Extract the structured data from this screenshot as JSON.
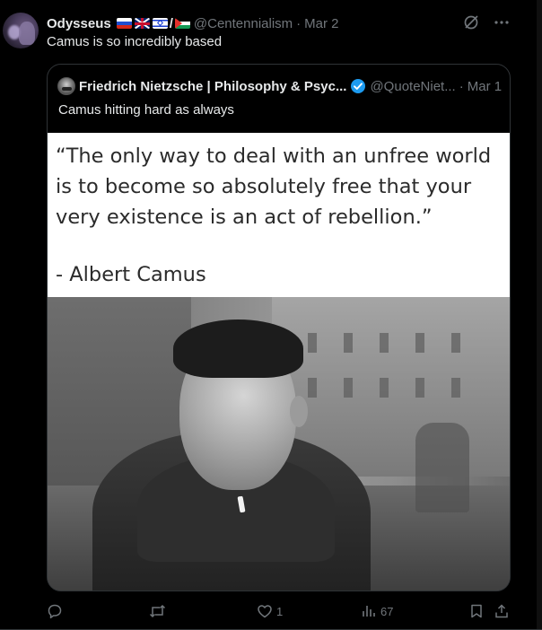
{
  "author": {
    "display_name": "Odysseus",
    "flag_separator": "/",
    "handle": "@Centennialism",
    "separator": "·",
    "date": "Mar 2"
  },
  "tweet_text": "Camus is so incredibly based",
  "quoted": {
    "display_name": "Friedrich Nietzsche | Philosophy & Psyc...",
    "handle": "@QuoteNiet...",
    "separator": "·",
    "date": "Mar 1",
    "text": "Camus hitting hard as always",
    "image_quote": "“The only way to deal with an unfree world is to become so absolutely free that your very existence is an act of rebellion.”",
    "image_author": "- Albert Camus"
  },
  "actions": {
    "reply_count": "",
    "retweet_count": "",
    "like_count": "1",
    "view_count": "67"
  },
  "icons": {
    "top_right": [
      "grok-icon",
      "more-icon"
    ],
    "bar": [
      "reply-icon",
      "retweet-icon",
      "like-icon",
      "views-icon",
      "bookmark-icon",
      "share-icon"
    ]
  },
  "colors": {
    "background": "#000000",
    "text_primary": "#e7e9ea",
    "text_secondary": "#71767b",
    "border": "#2f3336",
    "verified": "#1d9bf0"
  }
}
